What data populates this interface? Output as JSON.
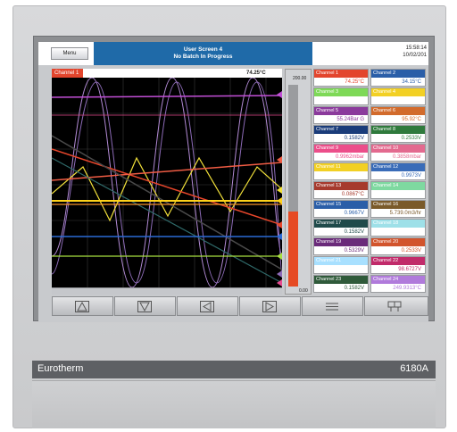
{
  "header": {
    "menu_label": "Menu",
    "screen_title": "User Screen 4",
    "batch_status": "No Batch In Progress",
    "time": "15:58:14",
    "date": "10/02/201"
  },
  "chart": {
    "channel_name": "Channel 1",
    "channel_value": "74.25°C",
    "scale_max": "200.00",
    "scale_min": "0.00",
    "bar_level": 0.37
  },
  "tiles": [
    {
      "name": "Channel 1",
      "value": "74.25°C",
      "color": "#e3452d"
    },
    {
      "name": "Channel 2",
      "value": "34.15°C",
      "color": "#2a5ea8"
    },
    {
      "name": "Channel 3",
      "value": "",
      "color": "#7ed957"
    },
    {
      "name": "Channel 4",
      "value": "",
      "color": "#f2d024"
    },
    {
      "name": "Channel 5",
      "value": "55.24Bar G",
      "color": "#8b3a9c"
    },
    {
      "name": "Channel 6",
      "value": "95.92°C",
      "color": "#d26b2c"
    },
    {
      "name": "Channel 7",
      "value": "0.1582V",
      "color": "#1a3c7a"
    },
    {
      "name": "Channel 8",
      "value": "0.2533V",
      "color": "#2f7a3c"
    },
    {
      "name": "Channel 9",
      "value": "0.9962mbar",
      "color": "#ec4e8a"
    },
    {
      "name": "Channel 10",
      "value": "0.3858mbar",
      "color": "#e36a8f"
    },
    {
      "name": "Channel 11",
      "value": "",
      "color": "#f2d024"
    },
    {
      "name": "Channel 12",
      "value": "0.9973V",
      "color": "#3a6cb8"
    },
    {
      "name": "Channel 13",
      "value": "0.0867°C",
      "color": "#a63a2d"
    },
    {
      "name": "Channel 14",
      "value": "",
      "color": "#7ed9a0"
    },
    {
      "name": "Channel 15",
      "value": "0.9667V",
      "color": "#2a5ea8"
    },
    {
      "name": "Channel 16",
      "value": "5.739.0m3/hr",
      "color": "#7a5a2a"
    },
    {
      "name": "Channel 17",
      "value": "0.1582V",
      "color": "#1f4a4a"
    },
    {
      "name": "Channel 18",
      "value": "",
      "color": "#9ee0e8"
    },
    {
      "name": "Channel 19",
      "value": "0.5329V",
      "color": "#6a2a7a"
    },
    {
      "name": "Channel 20",
      "value": "0.2533V",
      "color": "#d2542c"
    },
    {
      "name": "Channel 21",
      "value": "",
      "color": "#a8e0ff"
    },
    {
      "name": "Channel 22",
      "value": "98.6727V",
      "color": "#c12a6a"
    },
    {
      "name": "Channel 23",
      "value": "0.1582V",
      "color": "#2f5a3a"
    },
    {
      "name": "Channel 24",
      "value": "249.9313°C",
      "color": "#b07adb"
    }
  ],
  "nav_buttons": [
    "up",
    "down",
    "left",
    "right",
    "menu",
    "grid"
  ],
  "brand": {
    "maker": "Eurotherm",
    "model": "6180A"
  }
}
